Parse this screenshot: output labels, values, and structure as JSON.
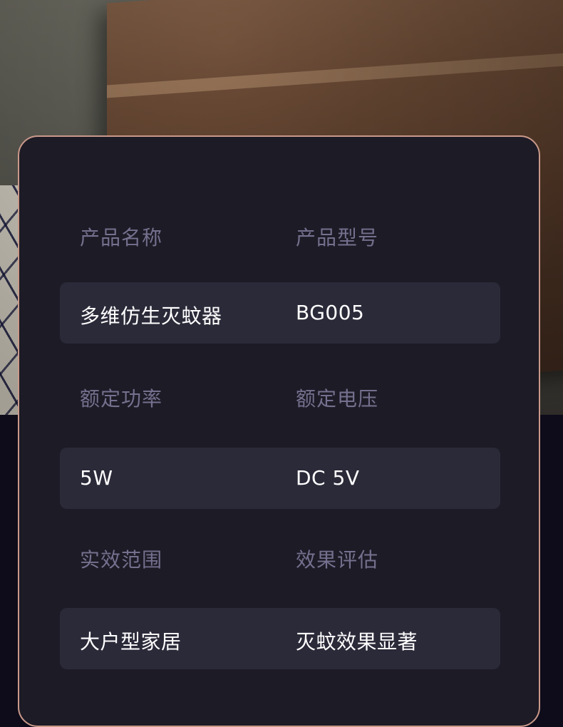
{
  "specs": {
    "rows": [
      {
        "label_left": "产品名称",
        "label_right": "产品型号",
        "value_left": "多维仿生灭蚊器",
        "value_right": "BG005"
      },
      {
        "label_left": "额定功率",
        "label_right": "额定电压",
        "value_left": "5W",
        "value_right": "DC 5V"
      },
      {
        "label_left": "实效范围",
        "label_right": "效果评估",
        "value_left": "大户型家居",
        "value_right": "灭蚊效果显著"
      }
    ]
  },
  "colors": {
    "page_background": "#0e0c1a",
    "card_background": "#1d1b26",
    "card_border": "#c9998a",
    "label_text": "#75708e",
    "value_row_background": "#2b2a39",
    "value_text": "#ffffff"
  }
}
